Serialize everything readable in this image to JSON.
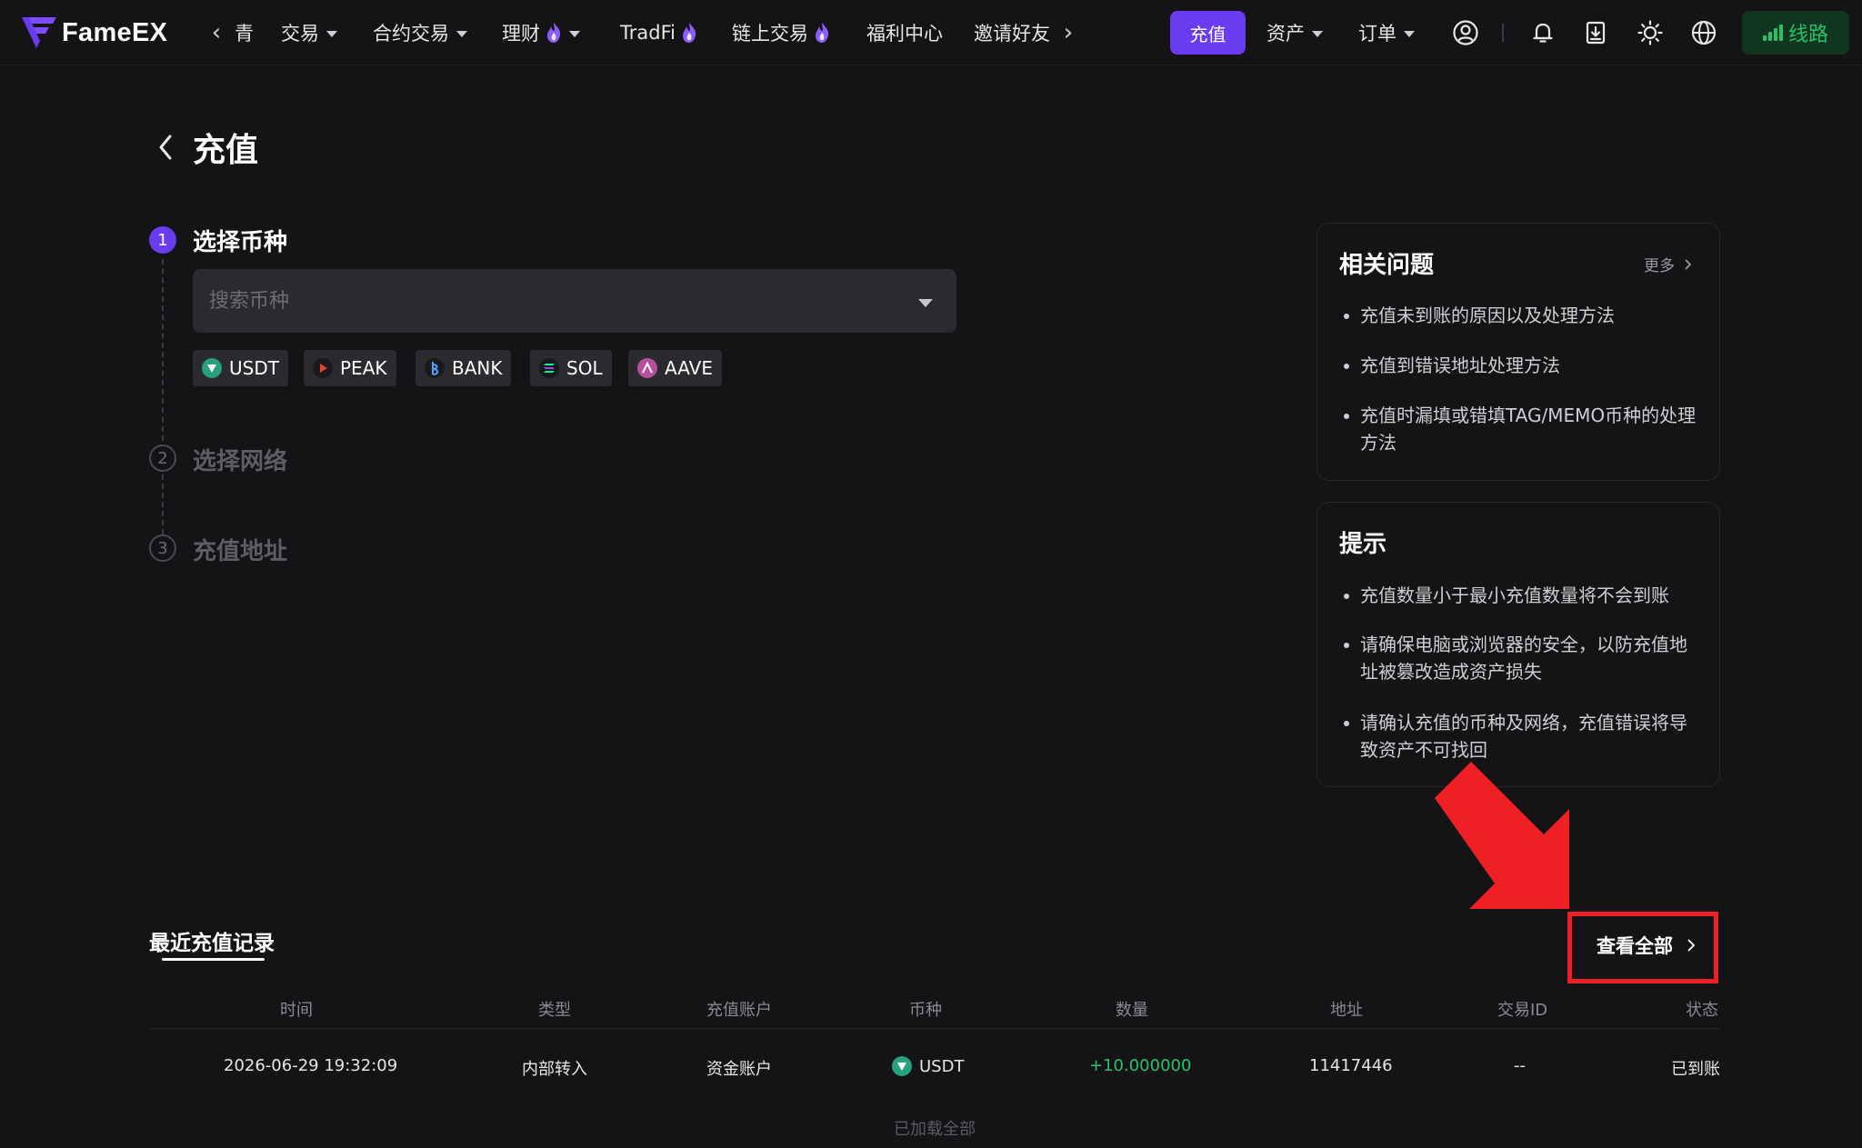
{
  "app": {
    "brand": "FameEX"
  },
  "nav": {
    "truncated_item": "青",
    "items": [
      {
        "label": "交易",
        "caret": true,
        "hot": false
      },
      {
        "label": "合约交易",
        "caret": true,
        "hot": false
      },
      {
        "label": "理财",
        "caret": true,
        "hot": true
      },
      {
        "label": "TradFi",
        "caret": false,
        "hot": true
      },
      {
        "label": "链上交易",
        "caret": false,
        "hot": true
      },
      {
        "label": "福利中心",
        "caret": false,
        "hot": false
      },
      {
        "label": "邀请好友",
        "caret": false,
        "hot": false
      }
    ],
    "deposit_button": "充值",
    "assets": "资产",
    "orders": "订单",
    "line_button": "线路",
    "icons": [
      "user-icon",
      "bell-icon",
      "download-icon",
      "sun-icon",
      "globe-icon"
    ]
  },
  "page": {
    "title": "充值",
    "steps": [
      {
        "num": "1",
        "label": "选择币种",
        "active": true
      },
      {
        "num": "2",
        "label": "选择网络",
        "active": false
      },
      {
        "num": "3",
        "label": "充值地址",
        "active": false
      }
    ],
    "search_placeholder": "搜索币种",
    "quick_coins": [
      {
        "symbol": "USDT",
        "color": "#26a17b"
      },
      {
        "symbol": "PEAK",
        "color": "#e0442d"
      },
      {
        "symbol": "BANK",
        "color": "#4aa3ff"
      },
      {
        "symbol": "SOL",
        "color": "#9945ff"
      },
      {
        "symbol": "AAVE",
        "color": "#b6509e"
      }
    ]
  },
  "faq": {
    "title": "相关问题",
    "more": "更多",
    "items": [
      "充值未到账的原因以及处理方法",
      "充值到错误地址处理方法",
      "充值时漏填或错填TAG/MEMO币种的处理方法"
    ]
  },
  "tips": {
    "title": "提示",
    "items": [
      "充值数量小于最小充值数量将不会到账",
      "请确保电脑或浏览器的安全，以防充值地址被篡改造成资产损失",
      "请确认充值的币种及网络，充值错误将导致资产不可找回"
    ]
  },
  "records": {
    "title": "最近充值记录",
    "view_all": "查看全部",
    "columns": [
      "时间",
      "类型",
      "充值账户",
      "币种",
      "数量",
      "地址",
      "交易ID",
      "状态"
    ],
    "rows": [
      {
        "time": "2026-06-29 19:32:09",
        "type": "内部转入",
        "account": "资金账户",
        "coin": "USDT",
        "amount": "+10.000000",
        "address": "11417446",
        "txid": "--",
        "status": "已到账"
      }
    ],
    "loaded_all": "已加载全部"
  },
  "colors": {
    "accent": "#6a3cf0",
    "positive": "#26c26b",
    "annotation": "#ee2026",
    "background": "#141416"
  }
}
